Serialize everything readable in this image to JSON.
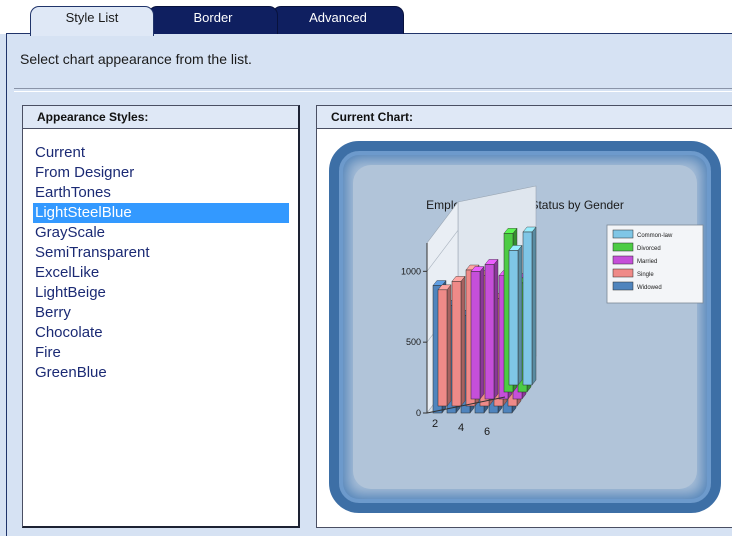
{
  "tabs": [
    {
      "label": "Style List",
      "active": true
    },
    {
      "label": "Border",
      "active": false
    },
    {
      "label": "Advanced",
      "active": false
    }
  ],
  "instruction": "Select chart appearance from the list.",
  "styles_panel": {
    "header": "Appearance Styles:",
    "items": [
      "Current",
      "From Designer",
      "EarthTones",
      "LightSteelBlue",
      "GrayScale",
      "SemiTransparent",
      "ExcelLike",
      "LightBeige",
      "Berry",
      "Chocolate",
      "Fire",
      "GreenBlue"
    ],
    "selected": "LightSteelBlue"
  },
  "chart_panel": {
    "header": "Current Chart:"
  },
  "colors": {
    "accent": "#3399ff",
    "tab_dark": "#0f1f60",
    "frame": "#3d6fa6"
  },
  "chart_data": {
    "type": "bar",
    "title": "Employees' Marital Status by Gender",
    "y_ticks": [
      "0",
      "500",
      "1000"
    ],
    "ylim": [
      0,
      1200
    ],
    "x_ticks": [
      "2",
      "4",
      "6"
    ],
    "legend_position": "top-right",
    "grid": true,
    "series": [
      {
        "name": "Common-law",
        "color": "#7fc6e6",
        "values": [
          null,
          null,
          null,
          null,
          950,
          1080
        ]
      },
      {
        "name": "Divorced",
        "color": "#4ccc44",
        "values": [
          null,
          null,
          null,
          null,
          1120,
          770
        ]
      },
      {
        "name": "Married",
        "color": "#c54fd9",
        "values": [
          null,
          null,
          900,
          950,
          870,
          850
        ]
      },
      {
        "name": "Single",
        "color": "#ef8a88",
        "values": [
          820,
          880,
          960,
          920,
          760,
          670
        ]
      },
      {
        "name": "Widowed",
        "color": "#4f84bd",
        "values": [
          900,
          760,
          690,
          720,
          600,
          300
        ]
      }
    ]
  }
}
